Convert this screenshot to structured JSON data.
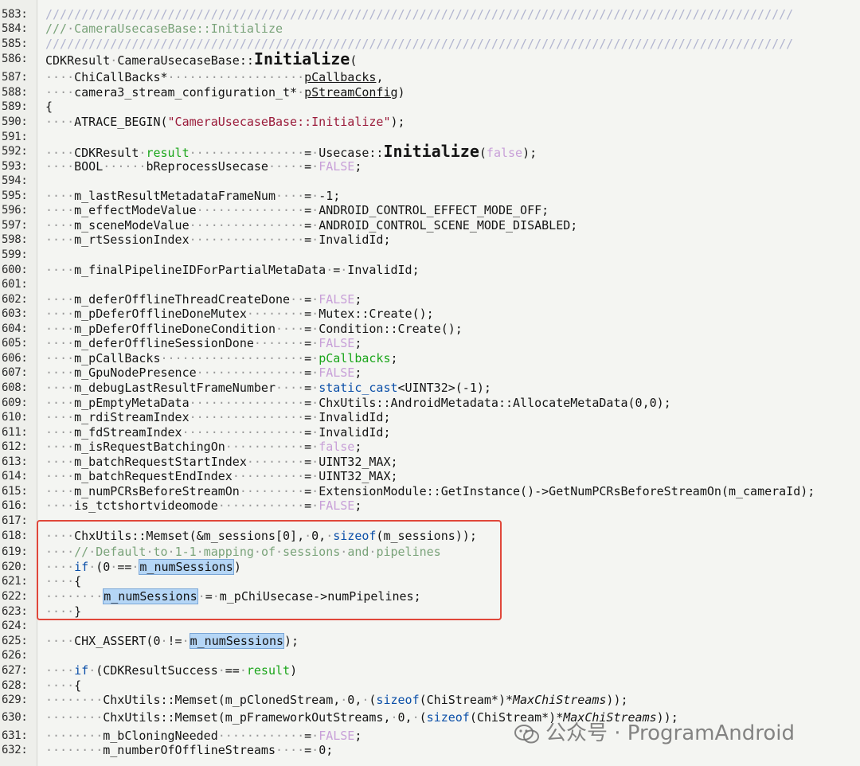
{
  "lines": [
    {
      "n": "583:",
      "c": "////////////////////////////////////////////////////////////////////////////////////////////////////////"
    },
    {
      "n": "584:",
      "c": "/// CameraUsecaseBase::Initialize"
    },
    {
      "n": "585:",
      "c": "////////////////////////////////////////////////////////////////////////////////////////////////////////"
    },
    {
      "n": "586:",
      "c": "CDKResult CameraUsecaseBase::Initialize("
    },
    {
      "n": "587:",
      "c": "    ChiCallBacks*                   pCallbacks,"
    },
    {
      "n": "588:",
      "c": "    camera3_stream_configuration_t* pStreamConfig)"
    },
    {
      "n": "589:",
      "c": "{"
    },
    {
      "n": "590:",
      "c": "    ATRACE_BEGIN(\"CameraUsecaseBase::Initialize\");"
    },
    {
      "n": "591:",
      "c": ""
    },
    {
      "n": "592:",
      "c": "    CDKResult result                = Usecase::Initialize(false);"
    },
    {
      "n": "593:",
      "c": "    BOOL      bReprocessUsecase     = FALSE;"
    },
    {
      "n": "594:",
      "c": ""
    },
    {
      "n": "595:",
      "c": "    m_lastResultMetadataFrameNum    = -1;"
    },
    {
      "n": "596:",
      "c": "    m_effectModeValue               = ANDROID_CONTROL_EFFECT_MODE_OFF;"
    },
    {
      "n": "597:",
      "c": "    m_sceneModeValue                = ANDROID_CONTROL_SCENE_MODE_DISABLED;"
    },
    {
      "n": "598:",
      "c": "    m_rtSessionIndex                = InvalidId;"
    },
    {
      "n": "599:",
      "c": ""
    },
    {
      "n": "600:",
      "c": "    m_finalPipelineIDForPartialMetaData = InvalidId;"
    },
    {
      "n": "601:",
      "c": ""
    },
    {
      "n": "602:",
      "c": "    m_deferOfflineThreadCreateDone  = FALSE;"
    },
    {
      "n": "603:",
      "c": "    m_pDeferOfflineDoneMutex        = Mutex::Create();"
    },
    {
      "n": "604:",
      "c": "    m_pDeferOfflineDoneCondition    = Condition::Create();"
    },
    {
      "n": "605:",
      "c": "    m_deferOfflineSessionDone       = FALSE;"
    },
    {
      "n": "606:",
      "c": "    m_pCallBacks                    = pCallbacks;"
    },
    {
      "n": "607:",
      "c": "    m_GpuNodePresence               = FALSE;"
    },
    {
      "n": "608:",
      "c": "    m_debugLastResultFrameNumber    = static_cast<UINT32>(-1);"
    },
    {
      "n": "609:",
      "c": "    m_pEmptyMetaData                = ChxUtils::AndroidMetadata::AllocateMetaData(0,0);"
    },
    {
      "n": "610:",
      "c": "    m_rdiStreamIndex                = InvalidId;"
    },
    {
      "n": "611:",
      "c": "    m_fdStreamIndex                 = InvalidId;"
    },
    {
      "n": "612:",
      "c": "    m_isRequestBatchingOn           = false;"
    },
    {
      "n": "613:",
      "c": "    m_batchRequestStartIndex        = UINT32_MAX;"
    },
    {
      "n": "614:",
      "c": "    m_batchRequestEndIndex          = UINT32_MAX;"
    },
    {
      "n": "615:",
      "c": "    m_numPCRsBeforeStreamOn         = ExtensionModule::GetInstance()->GetNumPCRsBeforeStreamOn(m_cameraId);"
    },
    {
      "n": "616:",
      "c": "    is_tctshortvideomode            = FALSE;"
    },
    {
      "n": "617:",
      "c": ""
    },
    {
      "n": "618:",
      "c": "    ChxUtils::Memset(&m_sessions[0], 0, sizeof(m_sessions));"
    },
    {
      "n": "619:",
      "c": "    // Default to 1-1 mapping of sessions and pipelines"
    },
    {
      "n": "620:",
      "c": "    if (0 == m_numSessions)"
    },
    {
      "n": "621:",
      "c": "    {"
    },
    {
      "n": "622:",
      "c": "        m_numSessions = m_pChiUsecase->numPipelines;"
    },
    {
      "n": "623:",
      "c": "    }"
    },
    {
      "n": "624:",
      "c": ""
    },
    {
      "n": "625:",
      "c": "    CHX_ASSERT(0 != m_numSessions);"
    },
    {
      "n": "626:",
      "c": ""
    },
    {
      "n": "627:",
      "c": "    if (CDKResultSuccess == result)"
    },
    {
      "n": "628:",
      "c": "    {"
    },
    {
      "n": "629:",
      "c": "        ChxUtils::Memset(m_pClonedStream, 0, (sizeof(ChiStream*)*MaxChiStreams));"
    },
    {
      "n": "630:",
      "c": "        ChxUtils::Memset(m_pFrameworkOutStreams, 0, (sizeof(ChiStream*)*MaxChiStreams));"
    },
    {
      "n": "631:",
      "c": "        m_bCloningNeeded            = FALSE;"
    },
    {
      "n": "632:",
      "c": "        m_numberOfOfflineStreams    = 0;"
    }
  ],
  "watermark": "公众号 · ProgramAndroid",
  "icons": {
    "watermark_icon": "wechat-icon"
  },
  "colors": {
    "highlight_box": "#e0473a",
    "selection": "#b5d6f6"
  }
}
